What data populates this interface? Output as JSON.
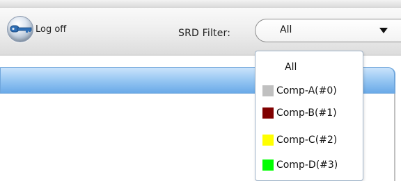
{
  "toolbar": {
    "logoff_label": "Log off",
    "logoff_icon": "key-icon",
    "filter_label": "SRD Filter:",
    "filter_selected": "All"
  },
  "dropdown": {
    "options": [
      {
        "label": "All"
      },
      {
        "label": "Comp-A(#0)",
        "color": "#c0c0c0"
      },
      {
        "label": "Comp-B(#1)",
        "color": "#800000"
      },
      {
        "label": "Comp-C(#2)",
        "color": "#ffff00"
      },
      {
        "label": "Comp-D(#3)",
        "color": "#00ff00"
      }
    ]
  },
  "colors": {
    "panel_header": "#96c6f2",
    "toolbar": "#ececec"
  }
}
